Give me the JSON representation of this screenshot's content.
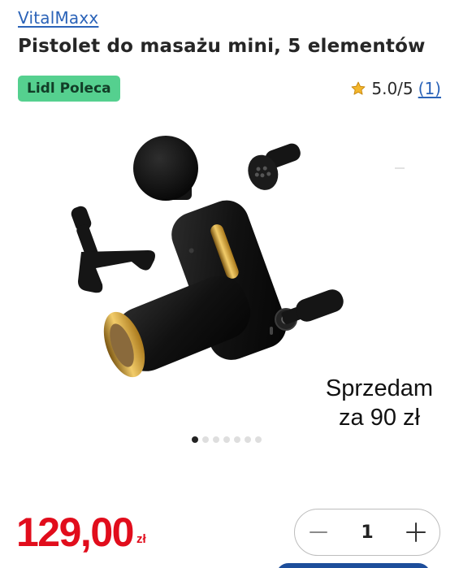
{
  "product": {
    "brand": "VitalMaxx",
    "title": "Pistolet do masażu mini, 5 elementów",
    "badge": "Lidl Poleca"
  },
  "rating": {
    "score": "5.0/5",
    "count": "(1)",
    "icon": "star-icon"
  },
  "gallery": {
    "overlay_line1": "Sprzedam",
    "overlay_line2": "za 90 zł",
    "image_count": 7,
    "active_index": 0
  },
  "price": {
    "amount": "129,00",
    "currency": "zł",
    "color": "#e10d1c"
  },
  "quantity": {
    "value": "1",
    "decrease_icon": "minus-icon",
    "increase_icon": "plus-icon"
  },
  "colors": {
    "link": "#2b63b8",
    "badge_bg": "#55d08f",
    "accent_gold": "#d9a93a",
    "cart_button": "#1d4e9b"
  }
}
